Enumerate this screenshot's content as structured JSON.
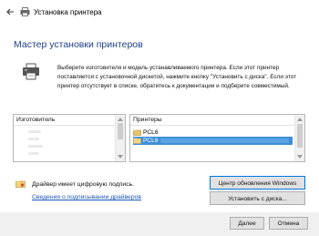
{
  "window": {
    "title": "Установка принтера"
  },
  "header": {
    "heading": "Мастер установки принтеров"
  },
  "intro": {
    "description": "Выберите изготовителя и модель устанавливаемого принтера. Если этот принтер поставляется с установочной дискетой, нажмите кнопку \"Установить с диска\". Если этот принтер отсутствует в списке, обратитесь к документации и подберите совместимый."
  },
  "manufacturers": {
    "header": "Изготовитель"
  },
  "printers": {
    "header": "Принтеры",
    "items": [
      {
        "label": "PCL6",
        "selected": false
      },
      {
        "label": "PCL6",
        "selected": true
      }
    ]
  },
  "signature": {
    "status": "Драйвер имеет цифровую подпись.",
    "link": "Сведения о подписывании драйверов"
  },
  "buttons": {
    "windows_update": "Центр обновления Windows",
    "have_disk": "Установить с диска...",
    "next": "Далее",
    "cancel": "Отмена"
  },
  "colors": {
    "heading": "#1f3f8a",
    "selection": "#3f8fd8",
    "link": "#1a56b8",
    "focus_border": "#0078d7"
  }
}
